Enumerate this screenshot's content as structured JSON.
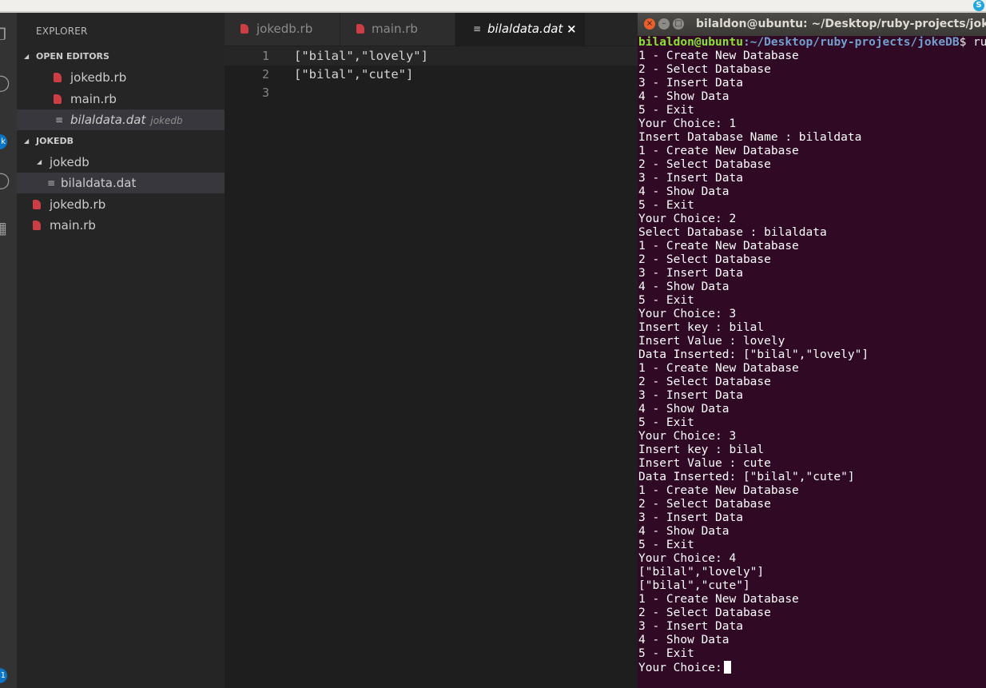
{
  "explorer": {
    "title": "EXPLORER",
    "open_editors": {
      "header": "OPEN EDITORS",
      "items": [
        {
          "name": "jokedb.rb"
        },
        {
          "name": "main.rb"
        },
        {
          "name": "bilaldata.dat",
          "folder": "jokedb"
        }
      ]
    },
    "project": {
      "header": "JOKEDB",
      "folder": "jokedb",
      "folder_file": "bilaldata.dat",
      "files": [
        "jokedb.rb",
        "main.rb"
      ]
    }
  },
  "activity_bar": {
    "badge": "k",
    "bottom_badge": "1",
    "icons": [
      "files-icon",
      "search-icon",
      "source-control-icon",
      "debug-icon",
      "extensions-icon"
    ]
  },
  "tabs": [
    {
      "label": "jokedb.rb",
      "icon": "ruby-icon"
    },
    {
      "label": "main.rb",
      "icon": "ruby-icon"
    },
    {
      "label": "bilaldata.dat",
      "icon": "file-lines-icon",
      "active": true,
      "close": "×"
    }
  ],
  "editor": {
    "lines": [
      {
        "number": "1",
        "text": "[\"bilal\",\"lovely\"]"
      },
      {
        "number": "2",
        "text": "[\"bilal\",\"cute\"]"
      },
      {
        "number": "3",
        "text": ""
      }
    ]
  },
  "terminal": {
    "window_title": "bilaldon@ubuntu: ~/Desktop/ruby-projects/jokeDB",
    "prompt_user": "bilaldon@ubuntu",
    "prompt_path": ":~/Desktop/ruby-projects/jokeDB",
    "prompt_symbol": "$ ruby main.rb",
    "lines": [
      "1 - Create New Database",
      "2 - Select Database",
      "3 - Insert Data",
      "4 - Show Data",
      "5 - Exit",
      "Your Choice: 1",
      "Insert Database Name : bilaldata",
      "1 - Create New Database",
      "2 - Select Database",
      "3 - Insert Data",
      "4 - Show Data",
      "5 - Exit",
      "Your Choice: 2",
      "Select Database : bilaldata",
      "1 - Create New Database",
      "2 - Select Database",
      "3 - Insert Data",
      "4 - Show Data",
      "5 - Exit",
      "Your Choice: 3",
      "Insert key : bilal",
      "Insert Value : lovely",
      "Data Inserted: [\"bilal\",\"lovely\"]",
      "1 - Create New Database",
      "2 - Select Database",
      "3 - Insert Data",
      "4 - Show Data",
      "5 - Exit",
      "Your Choice: 3",
      "Insert key : bilal",
      "Insert Value : cute",
      "Data Inserted: [\"bilal\",\"cute\"]",
      "1 - Create New Database",
      "2 - Select Database",
      "3 - Insert Data",
      "4 - Show Data",
      "5 - Exit",
      "Your Choice: 4",
      "[\"bilal\",\"lovely\"]",
      "[\"bilal\",\"cute\"]",
      "1 - Create New Database",
      "2 - Select Database",
      "3 - Insert Data",
      "4 - Show Data",
      "5 - Exit"
    ],
    "input_prompt": "Your Choice: "
  },
  "colors": {
    "sidebar_bg": "#252526",
    "editor_bg": "#1e1e1e",
    "terminal_bg": "#300a24",
    "ruby_icon": "#cc3e44",
    "prompt_user": "#8ae234",
    "prompt_path": "#729fcf"
  }
}
